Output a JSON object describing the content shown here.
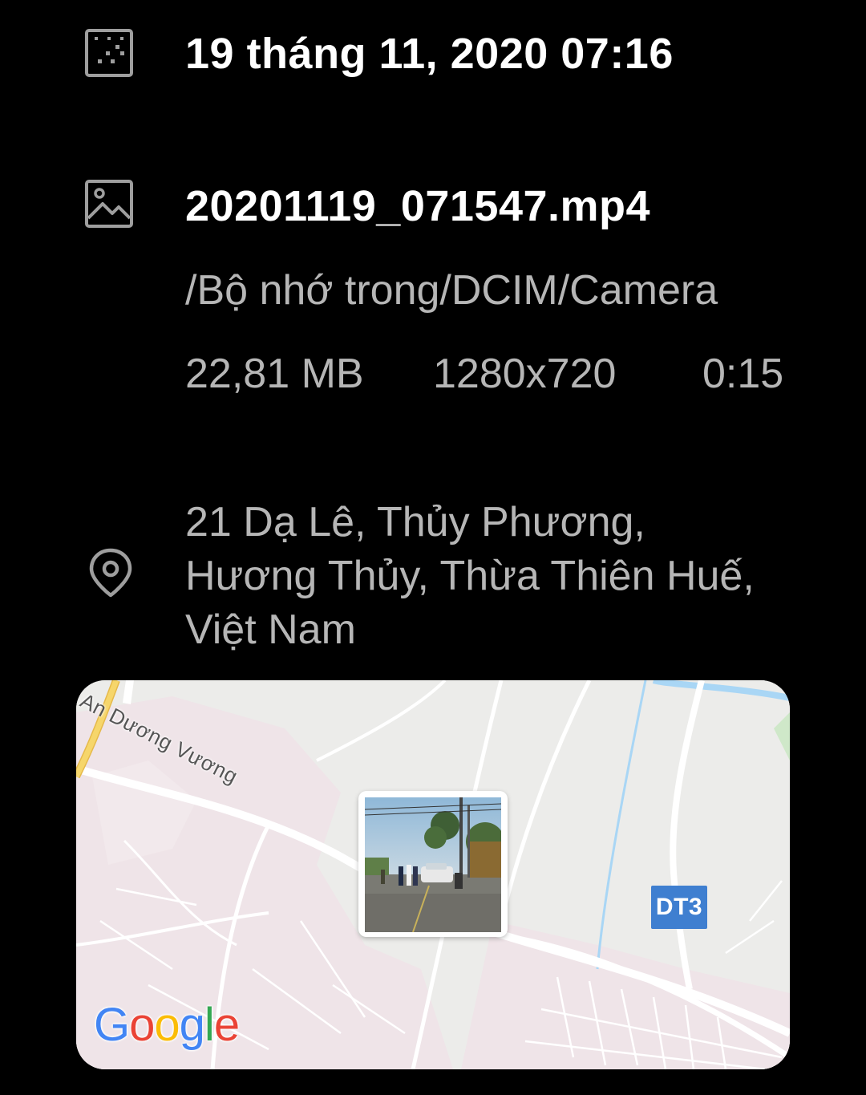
{
  "details": {
    "datetime": "19 tháng 11, 2020 07:16",
    "filename": "20201119_071547.mp4",
    "path": "/Bộ nhớ trong/DCIM/Camera",
    "size": "22,81 MB",
    "resolution": "1280x720",
    "duration": "0:15",
    "address_lines": [
      "21 Dạ Lê, Thủy Phương,",
      "Hương Thủy, Thừa Thiên Huế,",
      "Việt Nam"
    ]
  },
  "map": {
    "street_label": "An Dương Vương",
    "route_badge": "DT3",
    "logo_letters": [
      "G",
      "o",
      "o",
      "g",
      "l",
      "e"
    ],
    "logo_colors": [
      "#4285F4",
      "#EA4335",
      "#FBBC05",
      "#4285F4",
      "#34A853",
      "#EA4335"
    ],
    "colors": {
      "land": "#ececea",
      "urban": "#efe4e8",
      "road": "#ffffff",
      "highway": "#f6d66b",
      "water": "#a9d6f5",
      "badge": "#3f7fd0"
    }
  },
  "icons": {
    "date": "calendar-icon",
    "file": "image-icon",
    "location": "location-pin-icon"
  }
}
